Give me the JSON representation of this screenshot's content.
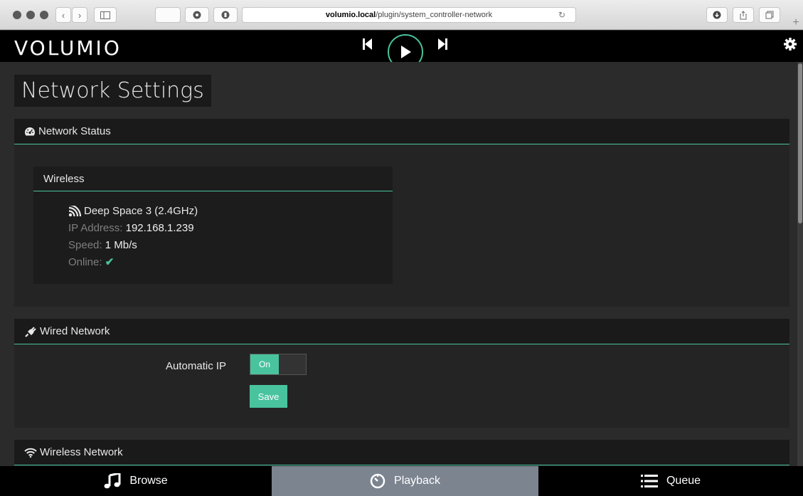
{
  "browser": {
    "url_host": "volumio.local",
    "url_path": "/plugin/system_controller-network"
  },
  "app": {
    "logo": "VOLUMIO"
  },
  "page": {
    "title": "Network Settings"
  },
  "network_status": {
    "heading": "Network Status",
    "wireless_card": {
      "title": "Wireless",
      "ssid": "Deep Space 3 (2.4GHz)",
      "ip_label": "IP Address:",
      "ip_value": "192.168.1.239",
      "speed_label": "Speed:",
      "speed_value": "1 Mb/s",
      "online_label": "Online:"
    }
  },
  "wired_network": {
    "heading": "Wired Network",
    "automatic_ip_label": "Automatic IP",
    "toggle_on_label": "On",
    "save_label": "Save"
  },
  "wireless_network": {
    "heading": "Wireless Network"
  },
  "footer": {
    "tabs": [
      {
        "label": "Browse",
        "icon": "music-note-icon"
      },
      {
        "label": "Playback",
        "icon": "clock-icon"
      },
      {
        "label": "Queue",
        "icon": "list-icon"
      }
    ]
  },
  "colors": {
    "accent": "#49c39e",
    "header_bg": "#000000",
    "panel_bg": "#242424",
    "active_tab_bg": "#7c8490"
  }
}
